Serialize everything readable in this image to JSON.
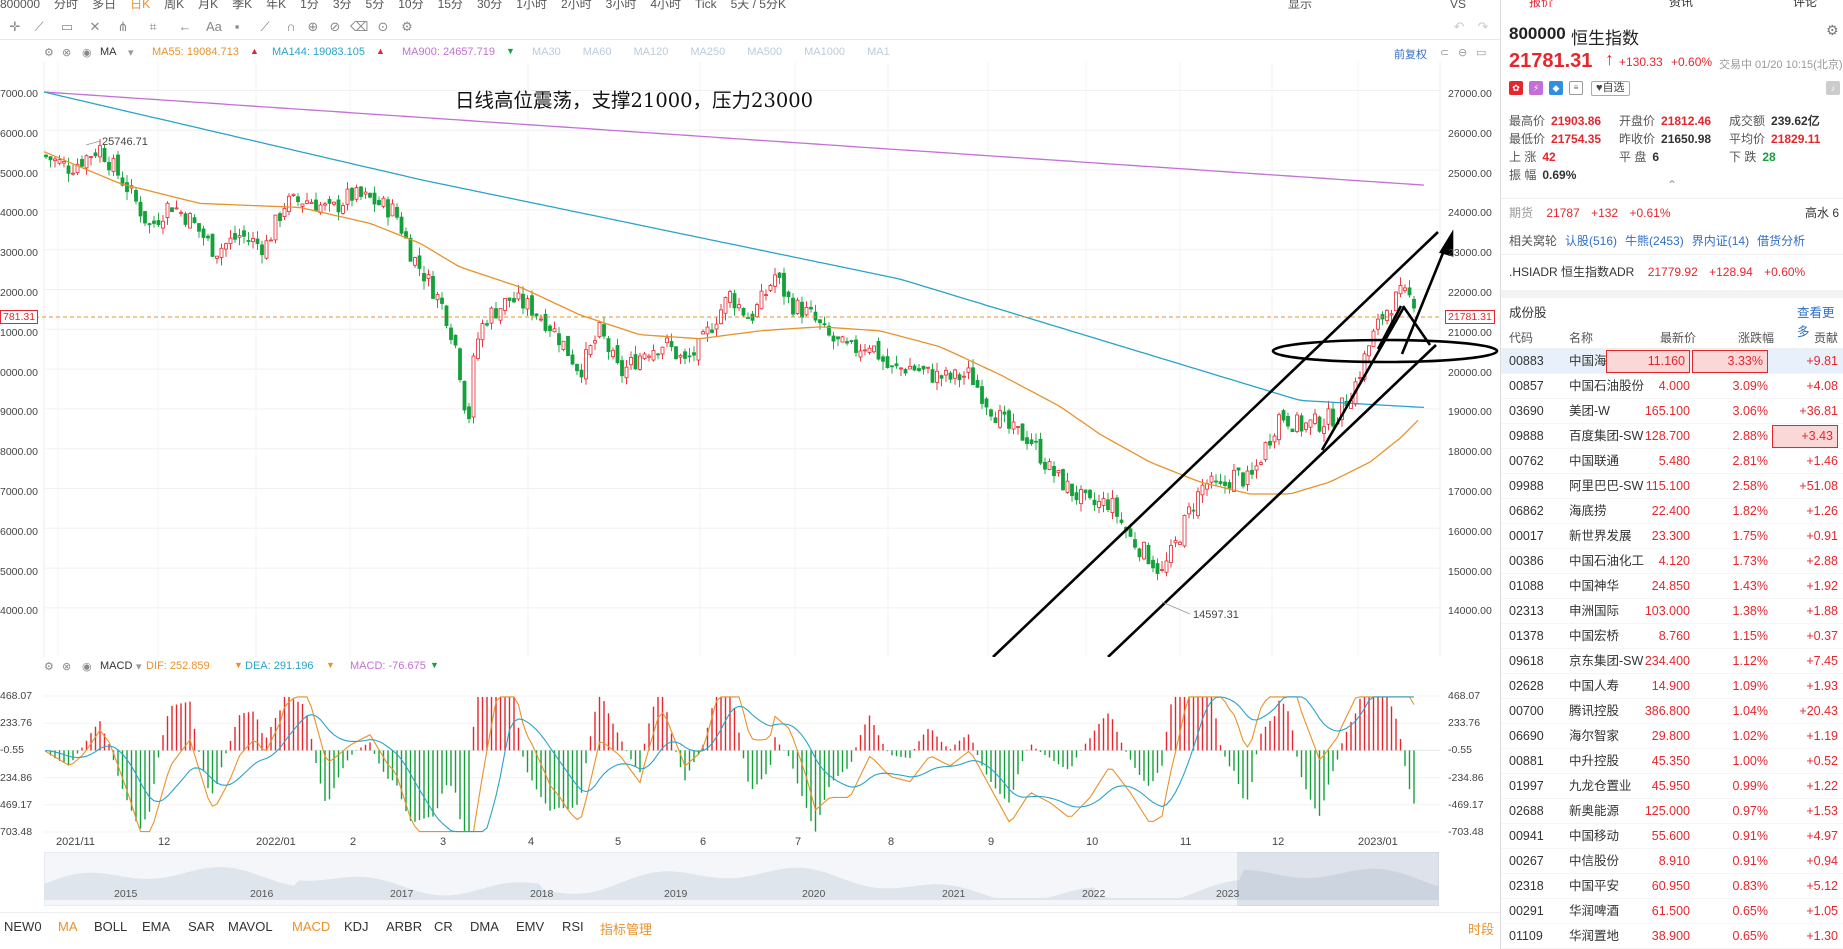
{
  "top_periods": [
    "800000",
    "分时",
    "多日",
    "日K",
    "周K",
    "月K",
    "季K",
    "年K",
    "1分",
    "3分",
    "5分",
    "10分",
    "15分",
    "30分",
    "1小时",
    "2小时",
    "3小时",
    "4小时",
    "Tick",
    "5天 / 5分K"
  ],
  "top_right": [
    "显示",
    "VS"
  ],
  "indicator_row": {
    "ma_label": "MA",
    "ma55": "MA55: 19084.713",
    "ma144": "MA144: 19083.105",
    "ma900": "MA900: 24657.719",
    "others": [
      "MA30",
      "MA60",
      "MA120",
      "MA250",
      "MA500",
      "MA1000",
      "MA1"
    ],
    "restore": "前复权"
  },
  "annotation": "日线高位震荡，支撑21000，压力23000",
  "price_axis": [
    "27000.00",
    "26000.00",
    "25000.00",
    "24000.00",
    "23000.00",
    "22000.00",
    "21000.00",
    "20000.00",
    "19000.00",
    "18000.00",
    "17000.00",
    "16000.00",
    "15000.00",
    "14000.00"
  ],
  "price_axis_left": [
    "7000.00",
    "6000.00",
    "5000.00",
    "4000.00",
    "3000.00",
    "2000.00",
    "1000.00",
    "0000.00",
    "9000.00",
    "8000.00",
    "7000.00",
    "6000.00",
    "5000.00",
    "4000.00"
  ],
  "current_price_tag": "21781.31",
  "current_price_tag_left": "781.31",
  "high_mark": "25746.71",
  "low_mark": "14597.31",
  "macd_row": {
    "label": "MACD",
    "dif": "DIF: 252.859",
    "dea": "DEA: 291.196",
    "macd": "MACD: -76.675"
  },
  "macd_axis": [
    "468.07",
    "233.76",
    "-0.55",
    "-234.86",
    "-469.17",
    "-703.48"
  ],
  "macd_axis_left": [
    "468.07",
    "233.76",
    "-0.55",
    "234.86",
    "469.17",
    "703.48"
  ],
  "time_axis": [
    "2021/11",
    "12",
    "2022/01",
    "2",
    "3",
    "4",
    "5",
    "6",
    "7",
    "8",
    "9",
    "10",
    "11",
    "12",
    "2023/01"
  ],
  "nav_years": [
    "2015",
    "2016",
    "2017",
    "2018",
    "2019",
    "2020",
    "2021",
    "2022",
    "2023"
  ],
  "bottom_tabs": [
    "NEW0",
    "MA",
    "BOLL",
    "EMA",
    "SAR",
    "MAVOL",
    "MACD",
    "KDJ",
    "ARBR",
    "CR",
    "DMA",
    "EMV",
    "RSI",
    "指标管理"
  ],
  "bottom_right": "时段",
  "panel": {
    "tabs": [
      "报价",
      "资讯",
      "评论"
    ],
    "code": "800000",
    "name": "恒生指数",
    "price": "21781.31",
    "change": "+130.33",
    "pct": "+0.60%",
    "status": "交易中 01/20 10:15(北京)",
    "fav": "自选",
    "stats": [
      [
        {
          "k": "最高价",
          "v": "21903.86",
          "c": "red"
        },
        {
          "k": "开盘价",
          "v": "21812.46",
          "c": "red"
        },
        {
          "k": "成交额",
          "v": "239.62亿",
          "c": ""
        }
      ],
      [
        {
          "k": "最低价",
          "v": "21754.35",
          "c": "red"
        },
        {
          "k": "昨收价",
          "v": "21650.98",
          "c": ""
        },
        {
          "k": "平均价",
          "v": "21829.11",
          "c": "red"
        }
      ],
      [
        {
          "k": "上  涨",
          "v": "42",
          "c": "red"
        },
        {
          "k": "平  盘",
          "v": "6",
          "c": ""
        },
        {
          "k": "下  跌",
          "v": "28",
          "c": "green"
        }
      ],
      [
        {
          "k": "振  幅",
          "v": "0.69%",
          "c": ""
        }
      ]
    ],
    "futures": {
      "label": "期货",
      "price": "21787",
      "chg": "+132",
      "pct": "+0.61%",
      "right": "高水 6"
    },
    "warrants": {
      "label": "相关窝轮",
      "items": [
        "认股(516)",
        "牛熊(2453)",
        "界内证(14)",
        "借货分析"
      ]
    },
    "adr": {
      "label": ".HSIADR 恒生指数ADR",
      "price": "21779.92",
      "chg": "+128.94",
      "pct": "+0.60%"
    },
    "constituents_title": "成份股",
    "more": "查看更多",
    "headers": [
      "代码",
      "名称",
      "最新价",
      "涨跌幅",
      "贡献"
    ],
    "rows": [
      [
        "00883",
        "中国海洋石油",
        "11.160",
        "3.33%",
        "+9.81"
      ],
      [
        "00857",
        "中国石油股份",
        "4.000",
        "3.09%",
        "+4.08"
      ],
      [
        "03690",
        "美团-W",
        "165.100",
        "3.06%",
        "+36.81"
      ],
      [
        "09888",
        "百度集团-SW",
        "128.700",
        "2.88%",
        "+3.43"
      ],
      [
        "00762",
        "中国联通",
        "5.480",
        "2.81%",
        "+1.46"
      ],
      [
        "09988",
        "阿里巴巴-SW",
        "115.100",
        "2.58%",
        "+51.08"
      ],
      [
        "06862",
        "海底捞",
        "22.400",
        "1.82%",
        "+1.26"
      ],
      [
        "00017",
        "新世界发展",
        "23.300",
        "1.75%",
        "+0.91"
      ],
      [
        "00386",
        "中国石油化工",
        "4.120",
        "1.73%",
        "+2.88"
      ],
      [
        "01088",
        "中国神华",
        "24.850",
        "1.43%",
        "+1.92"
      ],
      [
        "02313",
        "申洲国际",
        "103.000",
        "1.38%",
        "+1.88"
      ],
      [
        "01378",
        "中国宏桥",
        "8.760",
        "1.15%",
        "+0.37"
      ],
      [
        "09618",
        "京东集团-SW",
        "234.400",
        "1.12%",
        "+7.45"
      ],
      [
        "02628",
        "中国人寿",
        "14.900",
        "1.09%",
        "+1.93"
      ],
      [
        "00700",
        "腾讯控股",
        "386.800",
        "1.04%",
        "+20.43"
      ],
      [
        "06690",
        "海尔智家",
        "29.800",
        "1.02%",
        "+1.19"
      ],
      [
        "00881",
        "中升控股",
        "45.350",
        "1.00%",
        "+0.52"
      ],
      [
        "01997",
        "九龙仓置业",
        "45.950",
        "0.99%",
        "+1.22"
      ],
      [
        "02688",
        "新奥能源",
        "125.000",
        "0.97%",
        "+1.53"
      ],
      [
        "00941",
        "中国移动",
        "55.600",
        "0.91%",
        "+4.97"
      ],
      [
        "00267",
        "中信股份",
        "8.910",
        "0.91%",
        "+0.94"
      ],
      [
        "02318",
        "中国平安",
        "60.950",
        "0.83%",
        "+5.12"
      ],
      [
        "00291",
        "华润啤酒",
        "61.500",
        "0.65%",
        "+1.05"
      ],
      [
        "01109",
        "华润置地",
        "38.900",
        "0.65%",
        "+1.30"
      ]
    ]
  },
  "colors": {
    "up": "#e5262d",
    "down": "#13a13a",
    "ma55": "#e8922b",
    "ma144": "#2aa3c9",
    "ma900": "#c46fd6",
    "accent": "#2f6fc6"
  }
}
